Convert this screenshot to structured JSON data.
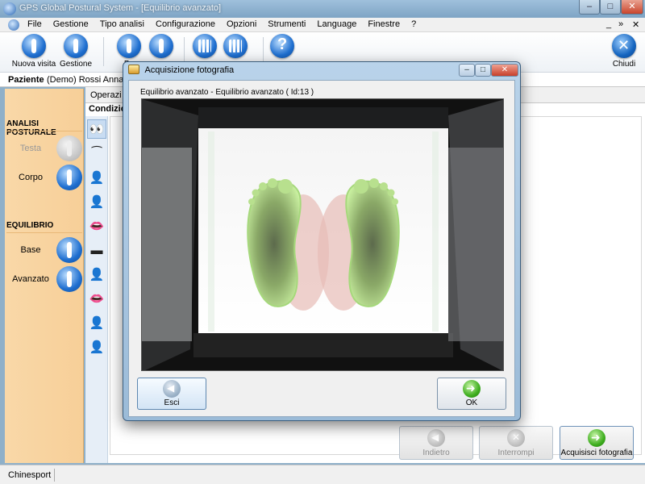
{
  "window": {
    "title": "GPS Global Postural System - [Equilibrio avanzato]"
  },
  "menu": {
    "items": [
      "File",
      "Gestione",
      "Tipo analisi",
      "Configurazione",
      "Opzioni",
      "Strumenti",
      "Language",
      "Finestre",
      "?"
    ],
    "controls": [
      "_",
      "»",
      "✕"
    ]
  },
  "toolbar": {
    "nuova_visita": "Nuova visita",
    "gestione": "Gestione",
    "paziente_partial": "Pa",
    "chiudi": "Chiudi"
  },
  "patient": {
    "label": "Paziente",
    "value": "(Demo) Rossi Anna"
  },
  "sidebar": {
    "analisi_posturale": "ANALISI POSTURALE",
    "testa": "Testa",
    "corpo": "Corpo",
    "equilibrio": "EQUILIBRIO",
    "base": "Base",
    "avanzato": "Avanzato"
  },
  "main": {
    "tab": "Operazi",
    "condizioni": "Condizion",
    "pose_icons": [
      "👀",
      "⁀",
      "👤",
      "👤",
      "👄",
      "▬",
      "👤",
      "👄",
      "👤",
      "👤"
    ]
  },
  "buttons": {
    "indietro": "Indietro",
    "interrompi": "Interrompi",
    "acquisisci": "Acquisisci fotografia"
  },
  "status": {
    "left": "Chinesport"
  },
  "dialog": {
    "title": "Acquisizione fotografia",
    "label": "Equilibrio avanzato - Equilibrio avanzato ( Id:13 )",
    "esci": "Esci",
    "ok": "OK",
    "ctrl_min": "–",
    "ctrl_max": "□",
    "ctrl_close": "✕"
  },
  "colors": {
    "sidebar": "#f7cf98",
    "toolbar_icon": "#1f6fd0",
    "ok_green": "#3fae1f",
    "dialog_frame": "#9bbbd8"
  }
}
